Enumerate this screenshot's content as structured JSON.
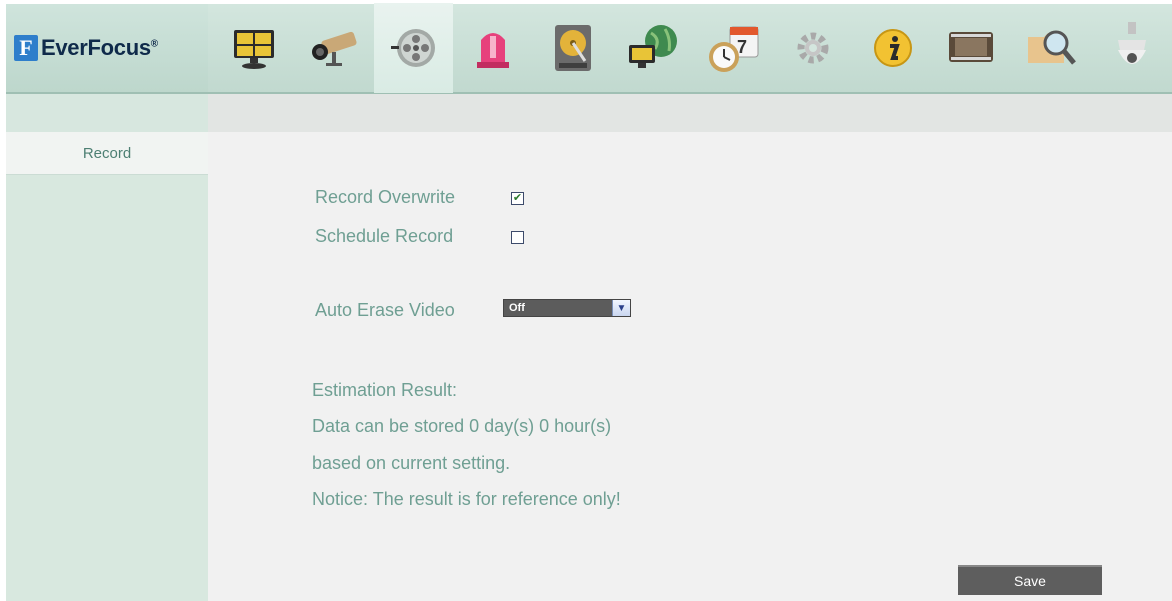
{
  "brand": {
    "mark": "F",
    "name": "EverFocus",
    "reg": "®"
  },
  "toolbar": {
    "items": [
      {
        "icon": "live-view-icon"
      },
      {
        "icon": "camera-icon"
      },
      {
        "icon": "record-reel-icon"
      },
      {
        "icon": "alarm-icon"
      },
      {
        "icon": "hard-disk-icon"
      },
      {
        "icon": "network-icon"
      },
      {
        "icon": "schedule-icon"
      },
      {
        "icon": "gear-icon"
      },
      {
        "icon": "info-icon"
      },
      {
        "icon": "playback-film-icon"
      },
      {
        "icon": "search-icon"
      },
      {
        "icon": "ptz-dome-icon"
      }
    ]
  },
  "sidebar": {
    "items": [
      {
        "label": "Record"
      }
    ]
  },
  "form": {
    "record_overwrite_label": "Record Overwrite",
    "record_overwrite_checked": true,
    "schedule_record_label": "Schedule Record",
    "schedule_record_checked": false,
    "auto_erase_label": "Auto Erase Video",
    "auto_erase_value": "Off"
  },
  "estimation": {
    "title": "Estimation Result:",
    "line1": "Data can be stored 0 day(s) 0 hour(s)",
    "line2": "based on current setting.",
    "notice": "Notice: The result is for reference only!"
  },
  "actions": {
    "save_label": "Save"
  },
  "colors": {
    "accent_green": "#6f9f93",
    "header_bg": "#c1d9cf",
    "button_bg": "#5e5e5e"
  }
}
